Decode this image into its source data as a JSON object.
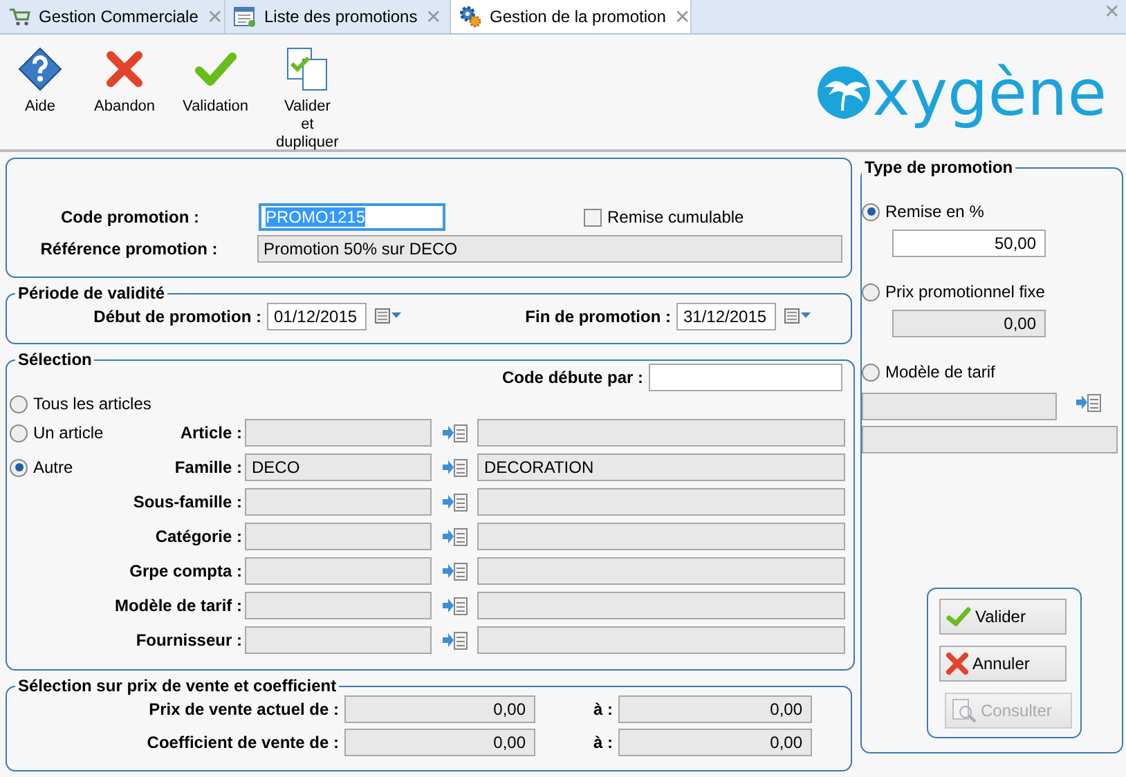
{
  "tabs": [
    {
      "label": "Gestion Commerciale",
      "close": "✕",
      "selected": false
    },
    {
      "label": "Liste des promotions",
      "close": "✕",
      "selected": false
    },
    {
      "label": "Gestion de la promotion",
      "close": "✕",
      "selected": true
    }
  ],
  "window_close": "✕",
  "toolbar": [
    {
      "label": "Aide",
      "kind": "help"
    },
    {
      "label": "Abandon",
      "kind": "cancel"
    },
    {
      "label": "Validation",
      "kind": "check"
    },
    {
      "label": "Valider\net\ndupliquer",
      "kind": "duplicate"
    }
  ],
  "logo": {
    "text": "xygène"
  },
  "header": {
    "code": {
      "label": "Code promotion :",
      "value": "PROMO1215",
      "focused": true
    },
    "cumulable": {
      "label": "Remise cumulable",
      "checked": false
    },
    "reference": {
      "label": "Référence promotion :",
      "value": "Promotion 50% sur DECO"
    }
  },
  "periode": {
    "title": "Période de validité",
    "debut": {
      "label": "Début de promotion :",
      "value": "01/12/2015"
    },
    "fin": {
      "label": "Fin de promotion :",
      "value": "31/12/2015"
    }
  },
  "selection": {
    "title": "Sélection",
    "code_debute": {
      "label": "Code débute par :"
    },
    "radios": [
      {
        "label": "Tous les articles",
        "selected": false
      },
      {
        "label": "Un article",
        "selected": false
      },
      {
        "label": "Autre",
        "selected": true
      }
    ],
    "rows": [
      {
        "label": "Article :"
      },
      {
        "label": "Famille :",
        "code": "DECO",
        "name": "DECORATION"
      },
      {
        "label": "Sous-famille :"
      },
      {
        "label": "Catégorie :"
      },
      {
        "label": "Grpe compta :"
      },
      {
        "label": "Modèle de tarif :"
      },
      {
        "label": "Fournisseur :"
      }
    ]
  },
  "prix": {
    "title": "Sélection sur prix de vente et coefficient",
    "rows": [
      {
        "label": "Prix de vente actuel de :",
        "from": "0,00",
        "to_label": "à :",
        "to": "0,00"
      },
      {
        "label": "Coefficient de vente de :",
        "from": "0,00",
        "to_label": "à :",
        "to": "0,00"
      }
    ]
  },
  "type_promotion": {
    "title": "Type de promotion",
    "options": [
      {
        "label": "Remise en %",
        "kind": "value",
        "selected": true,
        "value": "50,00",
        "disabled": false
      },
      {
        "label": "Prix promotionnel fixe",
        "kind": "value",
        "selected": false,
        "value": "0,00",
        "disabled": true
      },
      {
        "label": "Modèle de tarif",
        "kind": "lookup",
        "selected": false
      }
    ]
  },
  "actions": [
    {
      "label": "Valider",
      "kind": "check",
      "disabled": false
    },
    {
      "label": "Annuler",
      "kind": "cancel",
      "disabled": false
    },
    {
      "label": "Consulter",
      "kind": "search",
      "disabled": true
    }
  ]
}
